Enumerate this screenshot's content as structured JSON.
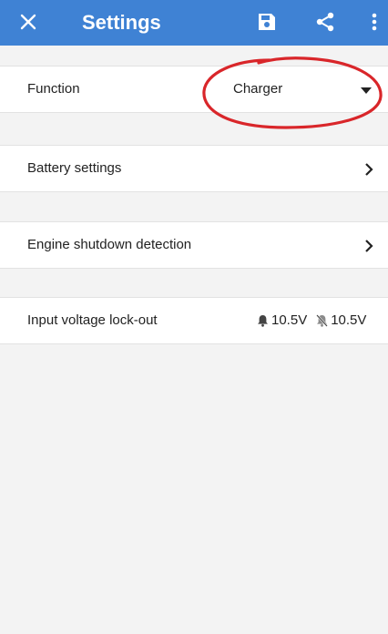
{
  "header": {
    "title": "Settings",
    "icons": [
      "close-icon",
      "save-icon",
      "share-icon",
      "more-vert-icon"
    ],
    "accent_color": "#3f82d4"
  },
  "rows": {
    "function": {
      "label": "Function",
      "value": "Charger"
    },
    "battery": {
      "label": "Battery settings"
    },
    "engine": {
      "label": "Engine shutdown detection"
    },
    "lockout": {
      "label": "Input voltage lock-out",
      "on_value": "10.5V",
      "off_value": "10.5V",
      "on_icon": "bell-icon",
      "off_icon": "bell-off-icon"
    }
  },
  "annotation": {
    "color": "#d9262a",
    "shape": "freehand-ellipse"
  }
}
